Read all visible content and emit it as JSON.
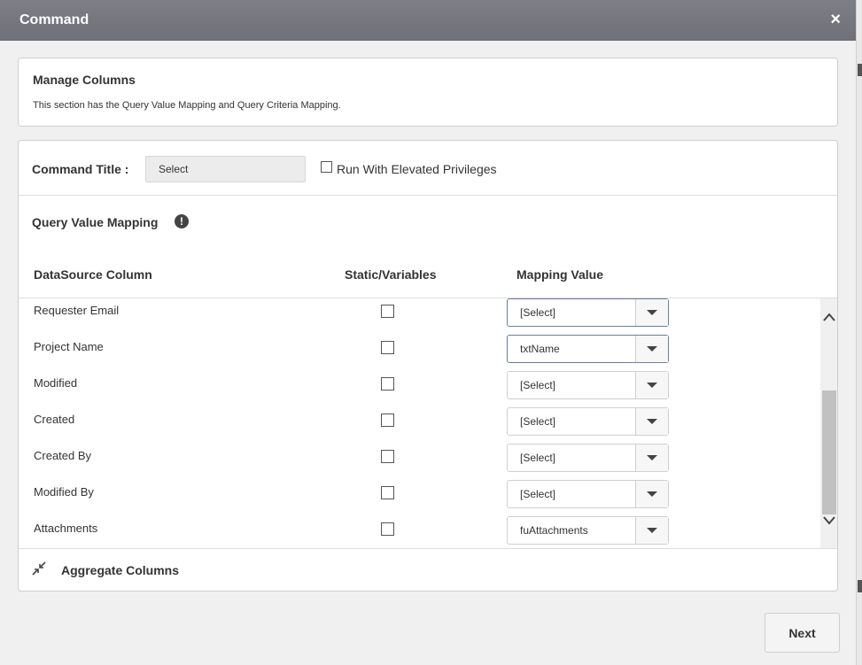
{
  "dialog": {
    "title": "Command",
    "close_icon": "×"
  },
  "manage_columns": {
    "heading": "Manage Columns",
    "description": "This section has the Query Value Mapping and Query Criteria Mapping."
  },
  "command": {
    "title_label": "Command Title :",
    "title_value": "Select",
    "elevated_label": "Run With Elevated Privileges"
  },
  "query_value_mapping": {
    "title": "Query Value Mapping",
    "info_icon": "!",
    "headers": {
      "datasource_column": "DataSource Column",
      "static_variables": "Static/Variables",
      "mapping_value": "Mapping Value"
    },
    "rows": [
      {
        "column": "Requester Email",
        "mapping": "[Select]"
      },
      {
        "column": "Project Name",
        "mapping": "txtName"
      },
      {
        "column": "Modified",
        "mapping": "[Select]"
      },
      {
        "column": "Created",
        "mapping": "[Select]"
      },
      {
        "column": "Created By",
        "mapping": "[Select]"
      },
      {
        "column": "Modified By",
        "mapping": "[Select]"
      },
      {
        "column": "Attachments",
        "mapping": "fuAttachments"
      }
    ]
  },
  "aggregate": {
    "label": "Aggregate Columns"
  },
  "footer": {
    "next_label": "Next"
  }
}
